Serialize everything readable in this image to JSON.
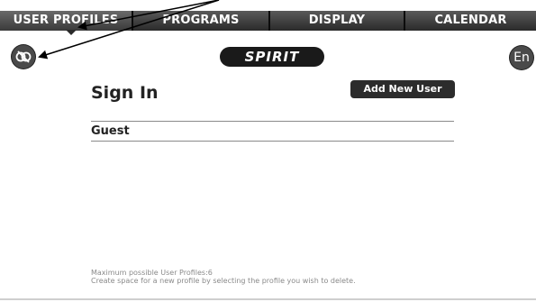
{
  "tabs": [
    {
      "label": "USER PROFILES",
      "active": true
    },
    {
      "label": "PROGRAMS",
      "active": false
    },
    {
      "label": "DISPLAY",
      "active": false
    },
    {
      "label": "CALENDAR",
      "active": false
    }
  ],
  "header": {
    "logo_text": "SPIRIT",
    "exit_icon": "exit-icon",
    "language_button": "En"
  },
  "main": {
    "title": "Sign In",
    "add_user_button": "Add New User",
    "profiles": [
      {
        "name": "Guest"
      }
    ]
  },
  "footer": {
    "max_profiles": "Maximum possible User Profiles:6",
    "hint": "Create space for a new profile by selecting the profile you wish to delete."
  },
  "colors": {
    "tab_bar": "#1c1c1c",
    "button_dark": "#2c2c2c",
    "annotation_arrow": "#000000"
  }
}
